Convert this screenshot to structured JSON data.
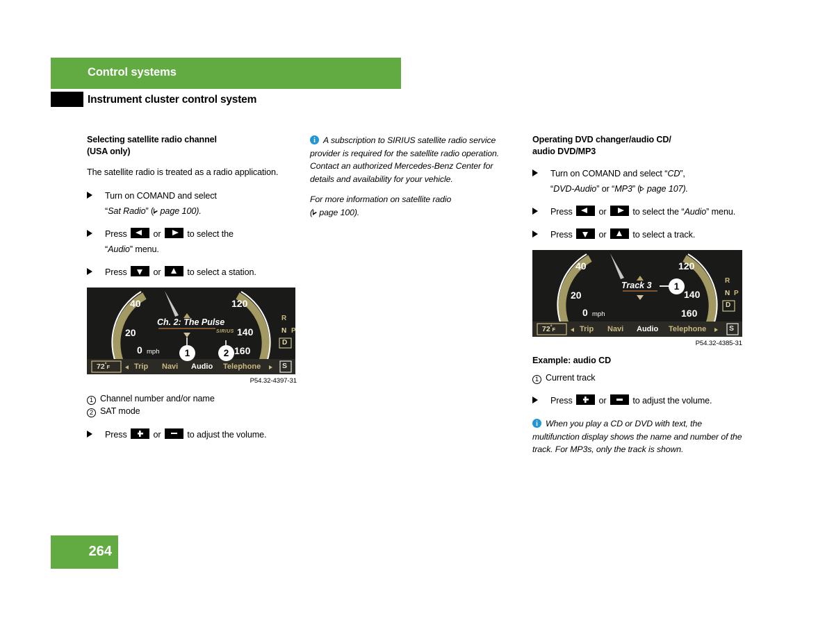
{
  "header": {
    "chapter": "Control systems",
    "section": "Instrument cluster control system",
    "green": "#62ab43"
  },
  "footer": {
    "page_number": "264"
  },
  "col1": {
    "heading_line1": "Selecting satellite radio channel",
    "heading_line2": "(USA only)",
    "intro": "The satellite radio is treated as a radio application.",
    "step1_pre": "Turn on COMAND and select",
    "step1_quote": "Sat Radio",
    "step1_ref": "page 100).",
    "step2_pre": "Press",
    "step2_mid": "or",
    "step2_post": "to select the",
    "step2_quote": "Audio",
    "step2_tail": "menu.",
    "step3_pre": "Press",
    "step3_mid": "or",
    "step3_post": "to select a station.",
    "figure_id": "P54.32-4397-31",
    "callout1_num": "1",
    "callout1_text": "Channel number and/or name",
    "callout2_num": "2",
    "callout2_text": "SAT mode",
    "step4_pre": "Press",
    "step4_mid": "or",
    "step4_post": "to adjust the volume."
  },
  "col2": {
    "note1": "A subscription to SIRIUS satellite radio service provider is required for the satellite radio operation. Contact an authorized Mercedes-Benz Center for details and availability for your vehicle.",
    "note2_pre": "For more information on satellite radio",
    "note2_ref": "page 100)."
  },
  "col3": {
    "heading_line1": "Operating DVD changer/audio CD/",
    "heading_line2": "audio DVD/MP3",
    "step1_pre": "Turn on COMAND and select",
    "step1_q1": "CD",
    "step1_q2": "DVD-Audio",
    "step1_or": "or",
    "step1_q3": "MP3",
    "step1_ref": "page 107).",
    "step2_pre": "Press",
    "step2_mid": "or",
    "step2_post": "to select the",
    "step2_quote": "Audio",
    "step2_tail": "menu.",
    "step3_pre": "Press",
    "step3_mid": "or",
    "step3_post": "to select a track.",
    "figure_id": "P54.32-4385-31",
    "example_label": "Example: audio CD",
    "callout1_num": "1",
    "callout1_text": "Current track",
    "step4_pre": "Press",
    "step4_mid": "or",
    "step4_post": "to adjust the volume.",
    "note1": "When you play a CD or DVD with text, the multifunction display shows the name and number of the track. For MP3s, only the track is shown."
  },
  "cluster_left": {
    "speed_0": "0",
    "speed_unit": "mph",
    "tick_20": "20",
    "tick_40": "40",
    "tick_120": "120",
    "tick_140": "140",
    "tick_160": "160",
    "display_text": "Ch. 2: The Pulse",
    "source_label": "SIRIUS",
    "temp": "72",
    "temp_unit": "F",
    "menu_trip": "Trip",
    "menu_navi": "Navi",
    "menu_audio": "Audio",
    "menu_phone": "Telephone",
    "gear_r": "R",
    "gear_n": "N",
    "gear_p": "P",
    "gear_d": "D",
    "badge_s": "S",
    "bubble1": "1",
    "bubble2": "2"
  },
  "cluster_right": {
    "speed_0": "0",
    "speed_unit": "mph",
    "tick_20": "20",
    "tick_40": "40",
    "tick_120": "120",
    "tick_140": "140",
    "tick_160": "160",
    "display_text": "Track 3",
    "temp": "72",
    "temp_unit": "F",
    "menu_trip": "Trip",
    "menu_navi": "Navi",
    "menu_audio": "Audio",
    "menu_phone": "Telephone",
    "gear_r": "R",
    "gear_n": "N",
    "gear_p": "P",
    "gear_d": "D",
    "badge_s": "S",
    "bubble1": "1"
  },
  "colors": {
    "cluster_bg": "#1a1a18",
    "gauge_gold": "#a39a63",
    "text_gold": "#c9b981",
    "accent_info": "#2196d6"
  }
}
